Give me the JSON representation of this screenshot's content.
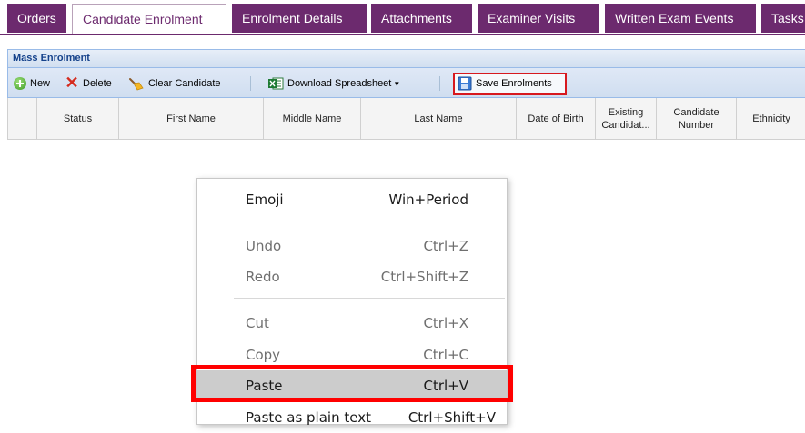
{
  "tabs": [
    {
      "label": "Orders",
      "active": false
    },
    {
      "label": "Candidate Enrolment",
      "active": true
    },
    {
      "label": "Enrolment Details",
      "active": false
    },
    {
      "label": "Attachments",
      "active": false
    },
    {
      "label": "Examiner Visits",
      "active": false
    },
    {
      "label": "Written Exam Events",
      "active": false
    },
    {
      "label": "Tasks",
      "active": false
    }
  ],
  "panel": {
    "title": "Mass Enrolment"
  },
  "toolbar": {
    "new_label": "New",
    "delete_label": "Delete",
    "clear_label": "Clear Candidate",
    "download_label": "Download Spreadsheet",
    "save_label": "Save Enrolments"
  },
  "grid": {
    "columns": [
      {
        "label": ""
      },
      {
        "label": "Status"
      },
      {
        "label": "First Name"
      },
      {
        "label": "Middle Name"
      },
      {
        "label": "Last Name"
      },
      {
        "label": "Date of Birth"
      },
      {
        "label": "Existing Candidat..."
      },
      {
        "label": "Candidate Number"
      },
      {
        "label": "Ethnicity"
      }
    ]
  },
  "context_menu": {
    "items": [
      {
        "label": "Emoji",
        "shortcut": "Win+Period",
        "enabled": true
      },
      {
        "label": "Undo",
        "shortcut": "Ctrl+Z",
        "enabled": false
      },
      {
        "label": "Redo",
        "shortcut": "Ctrl+Shift+Z",
        "enabled": false
      },
      {
        "label": "Cut",
        "shortcut": "Ctrl+X",
        "enabled": false
      },
      {
        "label": "Copy",
        "shortcut": "Ctrl+C",
        "enabled": false
      },
      {
        "label": "Paste",
        "shortcut": "Ctrl+V",
        "enabled": true,
        "highlighted": true
      },
      {
        "label": "Paste as plain text",
        "shortcut": "Ctrl+Shift+V",
        "enabled": true
      }
    ]
  },
  "colors": {
    "tab_background": "#6c2a6e",
    "highlight_box": "#ff0000",
    "save_box": "#d7191f"
  }
}
